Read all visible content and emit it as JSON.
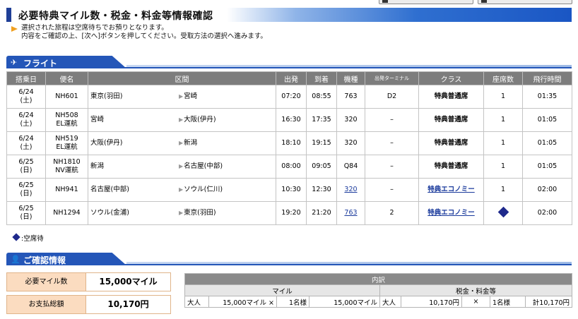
{
  "page_title": "必要特典マイル数・税金・料金等情報確認",
  "notice": [
    "選択された旅程は空席待ちでお預りとなります。",
    "内容をご確認の上、[次へ]ボタンを押してください。受取方法の選択へ進みます。"
  ],
  "flight_section": {
    "title": "フライト"
  },
  "flight_table": {
    "headers": [
      "搭乗日",
      "便名",
      "区間",
      "出発",
      "到着",
      "機種",
      "出発ターミナル",
      "クラス",
      "座席数",
      "飛行時間"
    ],
    "rows": [
      {
        "date": "6/24",
        "day": "(土)",
        "flight": "NH601",
        "flight_note": "",
        "from": "東京(羽田)",
        "to": "宮崎",
        "dep": "07:20",
        "arr": "08:55",
        "aircraft": "763",
        "aircraft_link": false,
        "terminal": "D2",
        "class": "特典普通席",
        "class_link": false,
        "seats": "1",
        "seat_waitlist": false,
        "duration": "01:35"
      },
      {
        "date": "6/24",
        "day": "(土)",
        "flight": "NH508",
        "flight_note": "EL運航",
        "from": "宮崎",
        "to": "大阪(伊丹)",
        "dep": "16:30",
        "arr": "17:35",
        "aircraft": "320",
        "aircraft_link": false,
        "terminal": "–",
        "class": "特典普通席",
        "class_link": false,
        "seats": "1",
        "seat_waitlist": false,
        "duration": "01:05"
      },
      {
        "date": "6/24",
        "day": "(土)",
        "flight": "NH519",
        "flight_note": "EL運航",
        "from": "大阪(伊丹)",
        "to": "新潟",
        "dep": "18:10",
        "arr": "19:15",
        "aircraft": "320",
        "aircraft_link": false,
        "terminal": "–",
        "class": "特典普通席",
        "class_link": false,
        "seats": "1",
        "seat_waitlist": false,
        "duration": "01:05"
      },
      {
        "date": "6/25",
        "day": "(日)",
        "flight": "NH1810",
        "flight_note": "NV運航",
        "from": "新潟",
        "to": "名古屋(中部)",
        "dep": "08:00",
        "arr": "09:05",
        "aircraft": "Q84",
        "aircraft_link": false,
        "terminal": "–",
        "class": "特典普通席",
        "class_link": false,
        "seats": "1",
        "seat_waitlist": false,
        "duration": "01:05"
      },
      {
        "date": "6/25",
        "day": "(日)",
        "flight": "NH941",
        "flight_note": "",
        "from": "名古屋(中部)",
        "to": "ソウル(仁川)",
        "dep": "10:30",
        "arr": "12:30",
        "aircraft": "320",
        "aircraft_link": true,
        "terminal": "–",
        "class": "特典エコノミー",
        "class_link": true,
        "seats": "1",
        "seat_waitlist": false,
        "duration": "02:00"
      },
      {
        "date": "6/25",
        "day": "(日)",
        "flight": "NH1294",
        "flight_note": "",
        "from": "ソウル(金浦)",
        "to": "東京(羽田)",
        "dep": "19:20",
        "arr": "21:20",
        "aircraft": "763",
        "aircraft_link": true,
        "terminal": "2",
        "class": "特典エコノミー",
        "class_link": true,
        "seats": "",
        "seat_waitlist": true,
        "duration": "02:00"
      }
    ]
  },
  "legend": {
    "waitlist_label": ":空席待"
  },
  "confirm_section": {
    "title": "ご確認情報"
  },
  "summary": {
    "miles_label": "必要マイル数",
    "miles_value": "15,000マイル",
    "payment_label": "お支払総額",
    "payment_value": "10,170円"
  },
  "breakdown": {
    "title": "内訳",
    "miles_header": "マイル",
    "tax_header": "税金・料金等",
    "passenger_type": "大人",
    "miles_unit": "15,000マイル ×",
    "miles_count": "1名様",
    "miles_total": "15,000マイル",
    "tax_passenger_type": "大人",
    "tax_unit": "10,170円",
    "tax_times": "×",
    "tax_count": "1名様",
    "tax_total": "計10,170円"
  }
}
